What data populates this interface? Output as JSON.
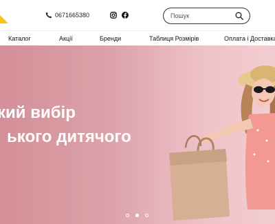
{
  "header": {
    "phone": "0671665380",
    "social": [
      "instagram-icon",
      "facebook-icon"
    ],
    "search": {
      "placeholder": "Пошук",
      "value": ""
    }
  },
  "nav": {
    "items": [
      "Каталог",
      "Акції",
      "Бренди",
      "Таблиця Розмірів",
      "Оплата і Доставка"
    ]
  },
  "hero": {
    "title_line1": "кий вибір",
    "title_line2": "ького дитячого",
    "slides": {
      "count": 3,
      "active": 2
    }
  },
  "colors": {
    "accent_logo": "#f5c518",
    "hero_bg": "#dca2a9",
    "text": "#111111"
  }
}
